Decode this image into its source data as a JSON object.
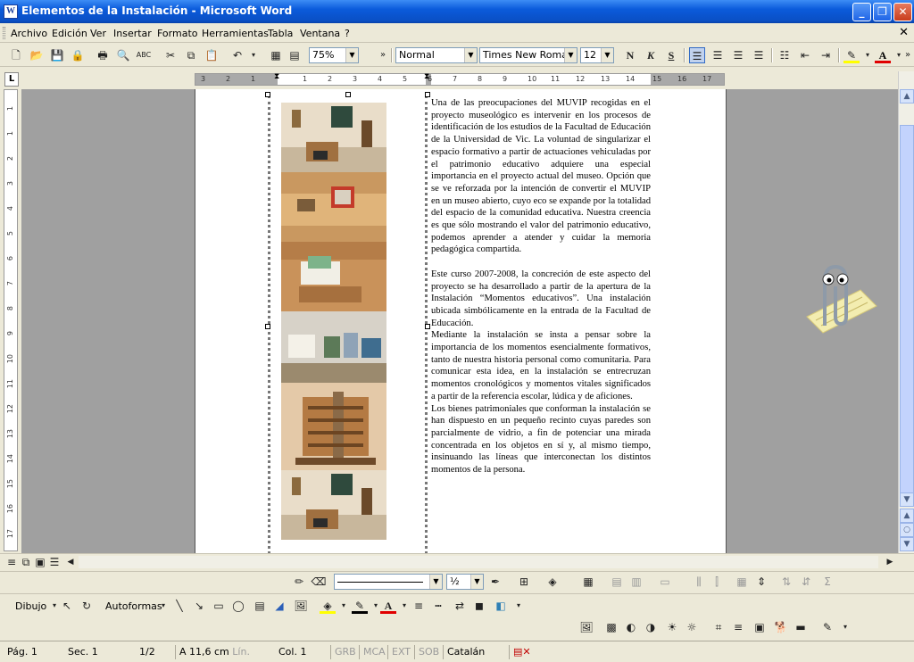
{
  "window": {
    "title": "Elementos de la Instalación - Microsoft Word",
    "app_icon": "W"
  },
  "menu": [
    "Archivo",
    "Edición",
    "Ver",
    "Insertar",
    "Formato",
    "Herramientas",
    "Tabla",
    "Ventana",
    "?"
  ],
  "toolbar": {
    "zoom": "75%",
    "style": "Normal",
    "font": "Times New Roman",
    "size": "12",
    "bold": "N",
    "italic": "K",
    "underline": "S"
  },
  "ruler": {
    "tab_selector": "L",
    "h_ticks": [
      "3",
      "2",
      "1",
      "1",
      "2",
      "3",
      "4",
      "5",
      "6",
      "7",
      "8",
      "9",
      "10",
      "11",
      "12",
      "13",
      "14",
      "15",
      "16",
      "17"
    ],
    "v_ticks": [
      "1",
      "1",
      "2",
      "3",
      "4",
      "5",
      "6",
      "7",
      "8",
      "9",
      "10",
      "11",
      "12",
      "13",
      "14",
      "15",
      "16",
      "17"
    ]
  },
  "document": {
    "paragraphs": [
      "Una de las preocupaciones del MUVIP recogidas en el proyecto museológico es intervenir en los procesos de identificación de los estudios de la Facultad de Educación de la Universidad de Vic. La voluntad de singularizar el espacio formativo a partir de actuaciones vehiculadas por el patrimonio educativo adquiere una especial importancia en el proyecto actual del museo. Opción que se ve reforzada por la intención de convertir el MUVIP en un museo abierto, cuyo eco se expande por la totalidad del espacio de la comunidad educativa. Nuestra creencia es que sólo mostrando el valor del patrimonio educativo, podemos aprender a atender y cuidar la memoria pedagógica compartida.",
      "Este curso 2007-2008, la concreción de este aspecto del proyecto se ha desarrollado a partir de la apertura de la Instalación “Momentos educativos”. Una instalación ubicada simbólicamente en la entrada de la Facultad de Educación.",
      "Mediante la instalación se insta a pensar sobre la importancia de los momentos esencialmente formativos, tanto de nuestra historia personal como comunitaria. Para comunicar esta idea, en la instalación se entrecruzan momentos cronológicos y momentos vitales significados a partir de la referencia escolar, lúdica y de aficiones.",
      "Los bienes patrimoniales que conforman la instalación se han dispuesto en un pequeño recinto cuyas paredes son parcialmente de vidrio, a fin de potenciar una mirada concentrada en los objetos en sí y, al mismo tiempo, insinuando las líneas que interconectan los distintos momentos de la persona."
    ]
  },
  "drawing_toolbar": {
    "dibujo": "Dibujo",
    "autoformas": "Autoformas",
    "line_width": "½"
  },
  "status": {
    "page": "Pág. 1",
    "section": "Sec. 1",
    "pages": "1/2",
    "at": "A 11,6 cm",
    "line": "Lín.",
    "col": "Col. 1",
    "grb": "GRB",
    "mca": "MCA",
    "ext": "EXT",
    "sob": "SOB",
    "language": "Catalán"
  }
}
